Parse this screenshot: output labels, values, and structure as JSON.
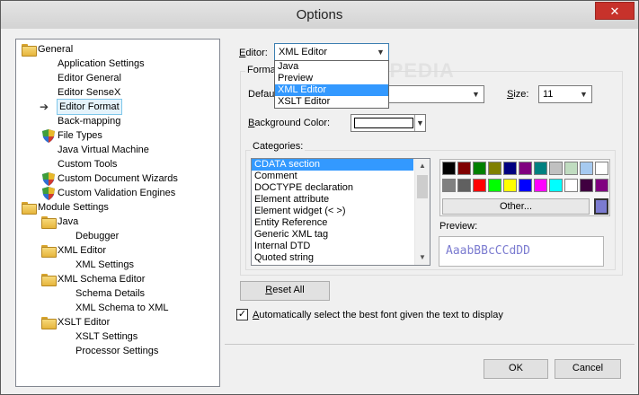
{
  "window": {
    "title": "Options",
    "close_label": "✕"
  },
  "tree": {
    "items": [
      {
        "label": "General",
        "icon": "folder-icon",
        "level": 0
      },
      {
        "label": "Application Settings",
        "icon": "",
        "level": 1
      },
      {
        "label": "Editor General",
        "icon": "",
        "level": 1
      },
      {
        "label": "Editor SenseX",
        "icon": "",
        "level": 1
      },
      {
        "label": "Editor Format",
        "icon": "arrow-icon",
        "level": 1,
        "selected": true
      },
      {
        "label": "Back-mapping",
        "icon": "",
        "level": 1
      },
      {
        "label": "File Types",
        "icon": "shield-icon",
        "level": 1
      },
      {
        "label": "Java Virtual Machine",
        "icon": "",
        "level": 1
      },
      {
        "label": "Custom Tools",
        "icon": "",
        "level": 1
      },
      {
        "label": "Custom Document Wizards",
        "icon": "shield-icon",
        "level": 1
      },
      {
        "label": "Custom Validation Engines",
        "icon": "shield-icon",
        "level": 1
      },
      {
        "label": "Module Settings",
        "icon": "folder-icon",
        "level": 0
      },
      {
        "label": "Java",
        "icon": "folder-icon",
        "level": 1
      },
      {
        "label": "Debugger",
        "icon": "",
        "level": 2
      },
      {
        "label": "XML Editor",
        "icon": "folder-icon",
        "level": 1
      },
      {
        "label": "XML Settings",
        "icon": "",
        "level": 2
      },
      {
        "label": "XML Schema Editor",
        "icon": "folder-icon",
        "level": 1
      },
      {
        "label": "Schema Details",
        "icon": "",
        "level": 2
      },
      {
        "label": "XML Schema to XML",
        "icon": "",
        "level": 2
      },
      {
        "label": "XSLT Editor",
        "icon": "folder-icon",
        "level": 1
      },
      {
        "label": "XSLT Settings",
        "icon": "",
        "level": 2
      },
      {
        "label": "Processor Settings",
        "icon": "",
        "level": 2
      }
    ]
  },
  "editor": {
    "label_pre": "",
    "label_acc": "E",
    "label_post": "ditor:",
    "value": "XML Editor",
    "options": [
      {
        "label": "Java",
        "selected": false
      },
      {
        "label": "Preview",
        "selected": false
      },
      {
        "label": "XML Editor",
        "selected": true
      },
      {
        "label": "XSLT Editor",
        "selected": false
      }
    ]
  },
  "format": {
    "group_title": "Format",
    "default_label": "Defaul",
    "size_label_acc": "S",
    "size_label_post": "ize:",
    "size_value": "11",
    "bg_label_acc": "B",
    "bg_label_post": "ackground Color:",
    "bg_color": "#ffffff"
  },
  "categories": {
    "title": "Categories:",
    "items": [
      {
        "label": "CDATA section",
        "selected": true
      },
      {
        "label": "Comment",
        "selected": false
      },
      {
        "label": "DOCTYPE declaration",
        "selected": false
      },
      {
        "label": "Element attribute",
        "selected": false
      },
      {
        "label": "Element widget (< >)",
        "selected": false
      },
      {
        "label": "Entity Reference",
        "selected": false
      },
      {
        "label": "Generic XML tag",
        "selected": false
      },
      {
        "label": "Internal DTD",
        "selected": false
      },
      {
        "label": "Quoted string",
        "selected": false
      }
    ]
  },
  "palette": {
    "row1": [
      "#000000",
      "#800000",
      "#008000",
      "#808000",
      "#000080",
      "#800080",
      "#008080",
      "#c0c0c0",
      "#c0dcc0",
      "#a6caf0",
      "#ffffff"
    ],
    "row2": [
      "#808080",
      "#606060",
      "#ff0000",
      "#00ff00",
      "#ffff00",
      "#0000ff",
      "#ff00ff",
      "#00ffff",
      "#ffffff",
      "#400040",
      "#800080"
    ],
    "other_label": "Other...",
    "current_color": "#7b7bd0"
  },
  "preview": {
    "label": "Preview:",
    "text": "AaabBBcCCdDD"
  },
  "reset_label": "Reset All",
  "auto_font": {
    "checked": true,
    "label_acc": "A",
    "label_post": "utomatically select the best font given the text to display"
  },
  "buttons": {
    "ok": "OK",
    "cancel": "Cancel"
  },
  "watermark": "SOFTPEDIA"
}
